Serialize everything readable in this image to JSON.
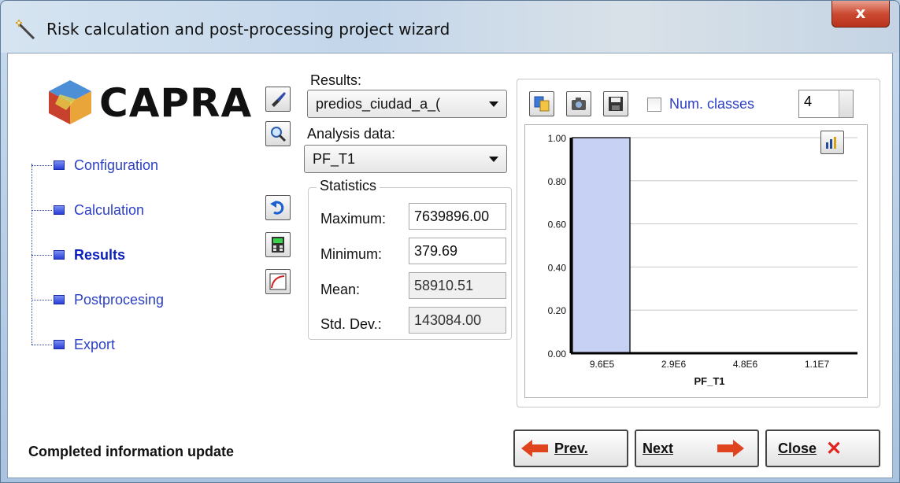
{
  "window": {
    "title": "Risk calculation and post-processing project wizard",
    "close_label": "x"
  },
  "logo": {
    "text": "CAPRA"
  },
  "nav": {
    "items": [
      {
        "label": "Configuration",
        "active": false
      },
      {
        "label": "Calculation",
        "active": false
      },
      {
        "label": "Results",
        "active": true
      },
      {
        "label": "Postprocesing",
        "active": false
      },
      {
        "label": "Export",
        "active": false
      }
    ]
  },
  "results": {
    "label": "Results:",
    "selected": "predios_ciudad_a_("
  },
  "analysis": {
    "label": "Analysis data:",
    "selected": "PF_T1"
  },
  "statistics": {
    "title": "Statistics",
    "rows": [
      {
        "label": "Maximum:",
        "value": "7639896.00"
      },
      {
        "label": "Minimum:",
        "value": "379.69"
      },
      {
        "label": "Mean:",
        "value": "58910.51"
      },
      {
        "label": "Std. Dev.:",
        "value": "143084.00"
      }
    ]
  },
  "chart_toolbar": {
    "num_classes_label": "Num. classes",
    "num_classes_value": "4"
  },
  "chart_data": {
    "type": "bar",
    "categories": [
      "9.6E5",
      "2.9E6",
      "4.8E6",
      "1.1E7"
    ],
    "values": [
      1.0,
      0.0,
      0.0,
      0.0
    ],
    "xlabel": "PF_T1",
    "ylim": [
      0,
      1.0
    ],
    "yticks": [
      "0.00",
      "0.20",
      "0.40",
      "0.60",
      "0.80",
      "1.00"
    ],
    "grid": true,
    "bar_color": "#c7d1f3"
  },
  "status": {
    "text": "Completed information update"
  },
  "buttons": {
    "prev": "Prev.",
    "next": "Next",
    "close": "Close"
  }
}
